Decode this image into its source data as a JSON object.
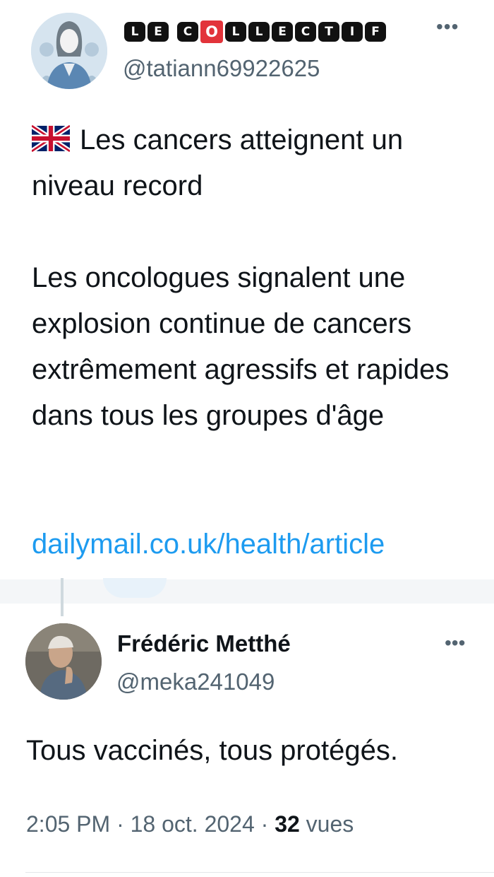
{
  "quoted_tweet": {
    "display_name_letters": [
      "L",
      "E",
      "C",
      "O",
      "L",
      "L",
      "E",
      "C",
      "T",
      "I",
      "F"
    ],
    "handle": "@tatiann69922625",
    "more_icon": "more-horizontal-icon",
    "flag_icon": "uk-flag-icon",
    "text_line1": "Les cancers atteignent un niveau record",
    "text_paragraph2": "Les oncologues signalent une explosion continue de cancers extrêmement agressifs et rapides dans tous les groupes d'âge",
    "link": "dailymail.co.uk/health/article",
    "link_color": "#1d9bf0"
  },
  "reply": {
    "display_name": "Frédéric Metthé",
    "handle": "@meka241049",
    "more_icon": "more-horizontal-icon",
    "text": "Tous vaccinés, tous protégés.",
    "time": "2:05 PM",
    "date": "18 oct. 2024",
    "views_count": "32",
    "views_label": "vues"
  },
  "colors": {
    "secondary_text": "#536471",
    "primary_text": "#0f1419",
    "brand_red": "#e2333a"
  }
}
